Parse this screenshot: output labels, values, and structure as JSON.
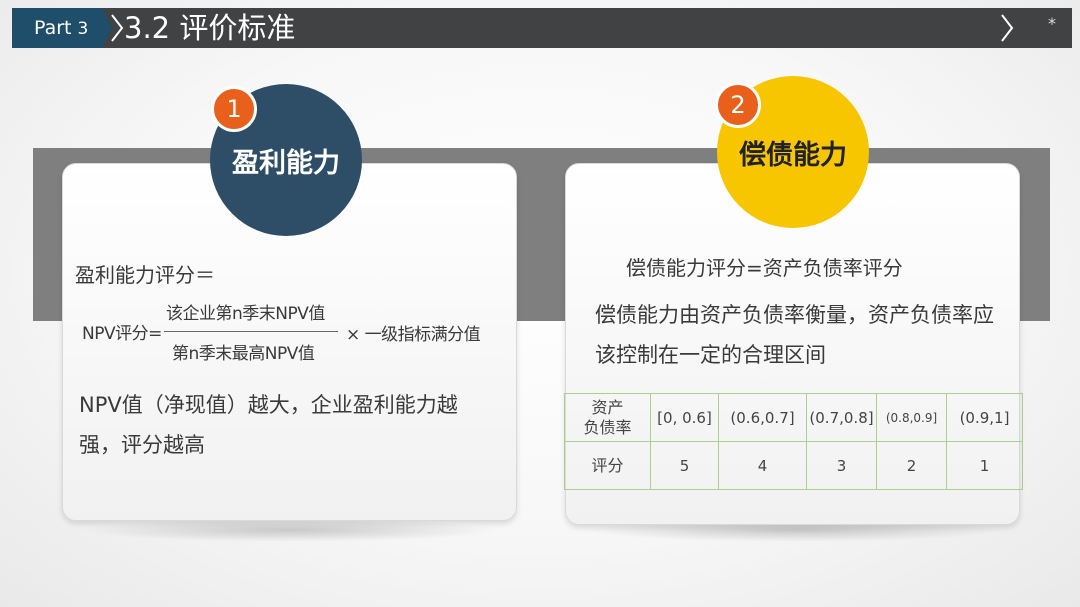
{
  "header": {
    "part_label": "Part",
    "part_number": "3",
    "title": "3.2 评价标准",
    "star": "*",
    "colors": {
      "bar": "#404243",
      "part_tab": "#1f4e6b"
    }
  },
  "left_card": {
    "badge": "1",
    "circle_label": "盈利能力",
    "formula_lhs": "盈利能力评分＝",
    "npv_label": "NPV评分=",
    "numerator": "该企业第n季末NPV值",
    "denominator": "第n季末最高NPV值",
    "multiplier": "× 一级指标满分值",
    "description": "NPV值（净现值）越大，企业盈利能力越强，评分越高",
    "colors": {
      "circle": "#2d4e66",
      "badge": "#e8601c"
    }
  },
  "right_card": {
    "badge": "2",
    "circle_label": "偿债能力",
    "formula": "偿债能力评分=资产负债率评分",
    "description": "偿债能力由资产负债率衡量，资产负债率应该控制在一定的合理区间",
    "table": {
      "header_label": "资产\n负债率",
      "ranges": [
        "[0, 0.6]",
        "(0.6,0.7]",
        "(0.7,0.8]",
        "(0.8,0.9]",
        "(0.9,1]"
      ],
      "score_label": "评分",
      "scores": [
        "5",
        "4",
        "3",
        "2",
        "1"
      ]
    },
    "colors": {
      "circle": "#f7c600",
      "badge": "#e8601c",
      "table_border": "#a9d18e"
    }
  }
}
